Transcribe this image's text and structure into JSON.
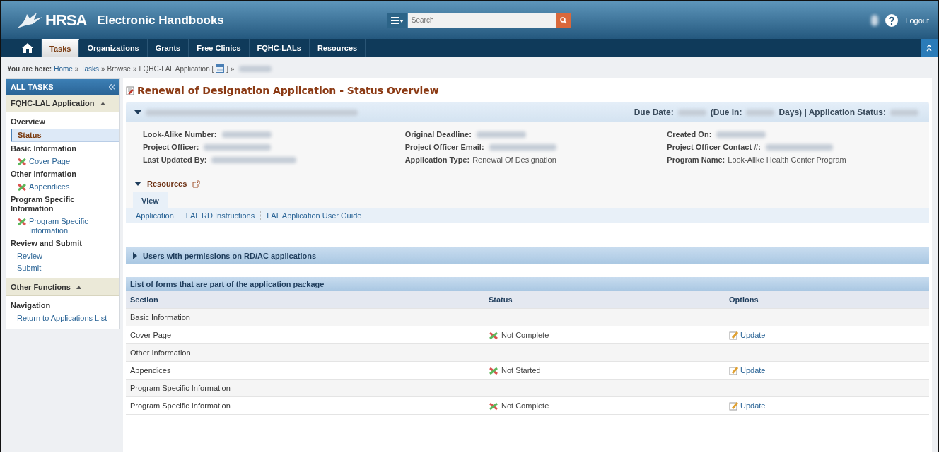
{
  "header": {
    "logo": "HRSA",
    "title": "Electronic Handbooks",
    "search": {
      "placeholder": "Search"
    },
    "logout": "Logout"
  },
  "nav": {
    "tabs": [
      {
        "kind": "home",
        "selected": false
      },
      {
        "kind": "text",
        "label": "Tasks",
        "selected": true
      },
      {
        "kind": "text",
        "label": "Organizations",
        "selected": false
      },
      {
        "kind": "text",
        "label": "Grants",
        "selected": false
      },
      {
        "kind": "text",
        "label": "Free Clinics",
        "selected": false
      },
      {
        "kind": "text",
        "label": "FQHC-LALs",
        "selected": false
      },
      {
        "kind": "text",
        "label": "Resources",
        "selected": false
      }
    ]
  },
  "breadcrumb": {
    "label": "You are here:",
    "parts": [
      {
        "kind": "link",
        "text": "Home"
      },
      {
        "kind": "text",
        "text": "»"
      },
      {
        "kind": "link",
        "text": "Tasks"
      },
      {
        "kind": "text",
        "text": "»"
      },
      {
        "kind": "text",
        "text": "Browse"
      },
      {
        "kind": "text",
        "text": "»"
      },
      {
        "kind": "text",
        "text": "FQHC-LAL Application ["
      },
      {
        "kind": "icon"
      },
      {
        "kind": "text",
        "text": "]"
      },
      {
        "kind": "text",
        "text": "»"
      },
      {
        "kind": "blurred"
      }
    ]
  },
  "sidebar": {
    "title": "ALL TASKS",
    "sections": [
      {
        "title": "FQHC-LAL Application",
        "expanded": true,
        "groups": [
          {
            "heading": "Overview",
            "items": [
              {
                "label": "Status",
                "selected": true,
                "incomplete": false
              }
            ]
          },
          {
            "heading": "Basic Information",
            "items": [
              {
                "label": "Cover Page",
                "selected": false,
                "incomplete": true
              }
            ]
          },
          {
            "heading": "Other Information",
            "items": [
              {
                "label": "Appendices",
                "selected": false,
                "incomplete": true
              }
            ]
          },
          {
            "heading": "Program Specific Information",
            "items": [
              {
                "label": "Program Specific Information",
                "selected": false,
                "incomplete": true
              }
            ]
          },
          {
            "heading": "Review and Submit",
            "items": [
              {
                "label": "Review",
                "selected": false,
                "incomplete": false
              },
              {
                "label": "Submit",
                "selected": false,
                "incomplete": false
              }
            ]
          }
        ]
      },
      {
        "title": "Other Functions",
        "expanded": true,
        "groups": [
          {
            "heading": "Navigation",
            "items": [
              {
                "label": "Return to Applications List",
                "selected": false,
                "incomplete": false
              }
            ]
          }
        ]
      }
    ]
  },
  "main": {
    "title": "Renewal of Designation Application - Status Overview",
    "panel": {
      "expanded": true,
      "due": [
        {
          "kind": "text",
          "text": "Due Date:"
        },
        {
          "kind": "blurred"
        },
        {
          "kind": "text",
          "text": "(Due In:"
        },
        {
          "kind": "blurred"
        },
        {
          "kind": "text",
          "text": "Days) | Application Status:"
        },
        {
          "kind": "blurred"
        }
      ],
      "details": [
        [
          {
            "label": "Look-Alike Number:",
            "hidden": true
          },
          {
            "label": "Project Officer:",
            "hidden": true
          },
          {
            "label": "Last Updated By:",
            "hidden": true
          }
        ],
        [
          {
            "label": "Original Deadline:",
            "hidden": true
          },
          {
            "label": "Project Officer Email:",
            "hidden": true
          },
          {
            "label": "Application Type:",
            "hidden": false,
            "value": "Renewal Of Designation"
          }
        ],
        [
          {
            "label": "Created On:",
            "hidden": true
          },
          {
            "label": "Project Officer Contact #:",
            "hidden": true
          },
          {
            "label": "Program Name:",
            "hidden": false,
            "value": "Look-Alike Health Center Program"
          }
        ]
      ]
    },
    "resources": {
      "title": "Resources",
      "expanded": true,
      "tab": "View",
      "links": [
        "Application",
        "LAL RD Instructions",
        "LAL Application User Guide"
      ]
    },
    "users": {
      "title": "Users with permissions on RD/AC applications",
      "expanded": false
    },
    "forms": {
      "caption": "List of forms that are part of the application package",
      "columns": [
        "Section",
        "Status",
        "Options"
      ],
      "rows": [
        {
          "kind": "group",
          "section": "Basic Information"
        },
        {
          "kind": "form",
          "section": "Cover Page",
          "status": "Not Complete",
          "option": "Update"
        },
        {
          "kind": "group",
          "section": "Other Information"
        },
        {
          "kind": "form",
          "section": "Appendices",
          "status": "Not Started",
          "option": "Update"
        },
        {
          "kind": "group",
          "section": "Program Specific Information"
        },
        {
          "kind": "form",
          "section": "Program Specific Information",
          "status": "Not Complete",
          "option": "Update"
        }
      ]
    }
  }
}
